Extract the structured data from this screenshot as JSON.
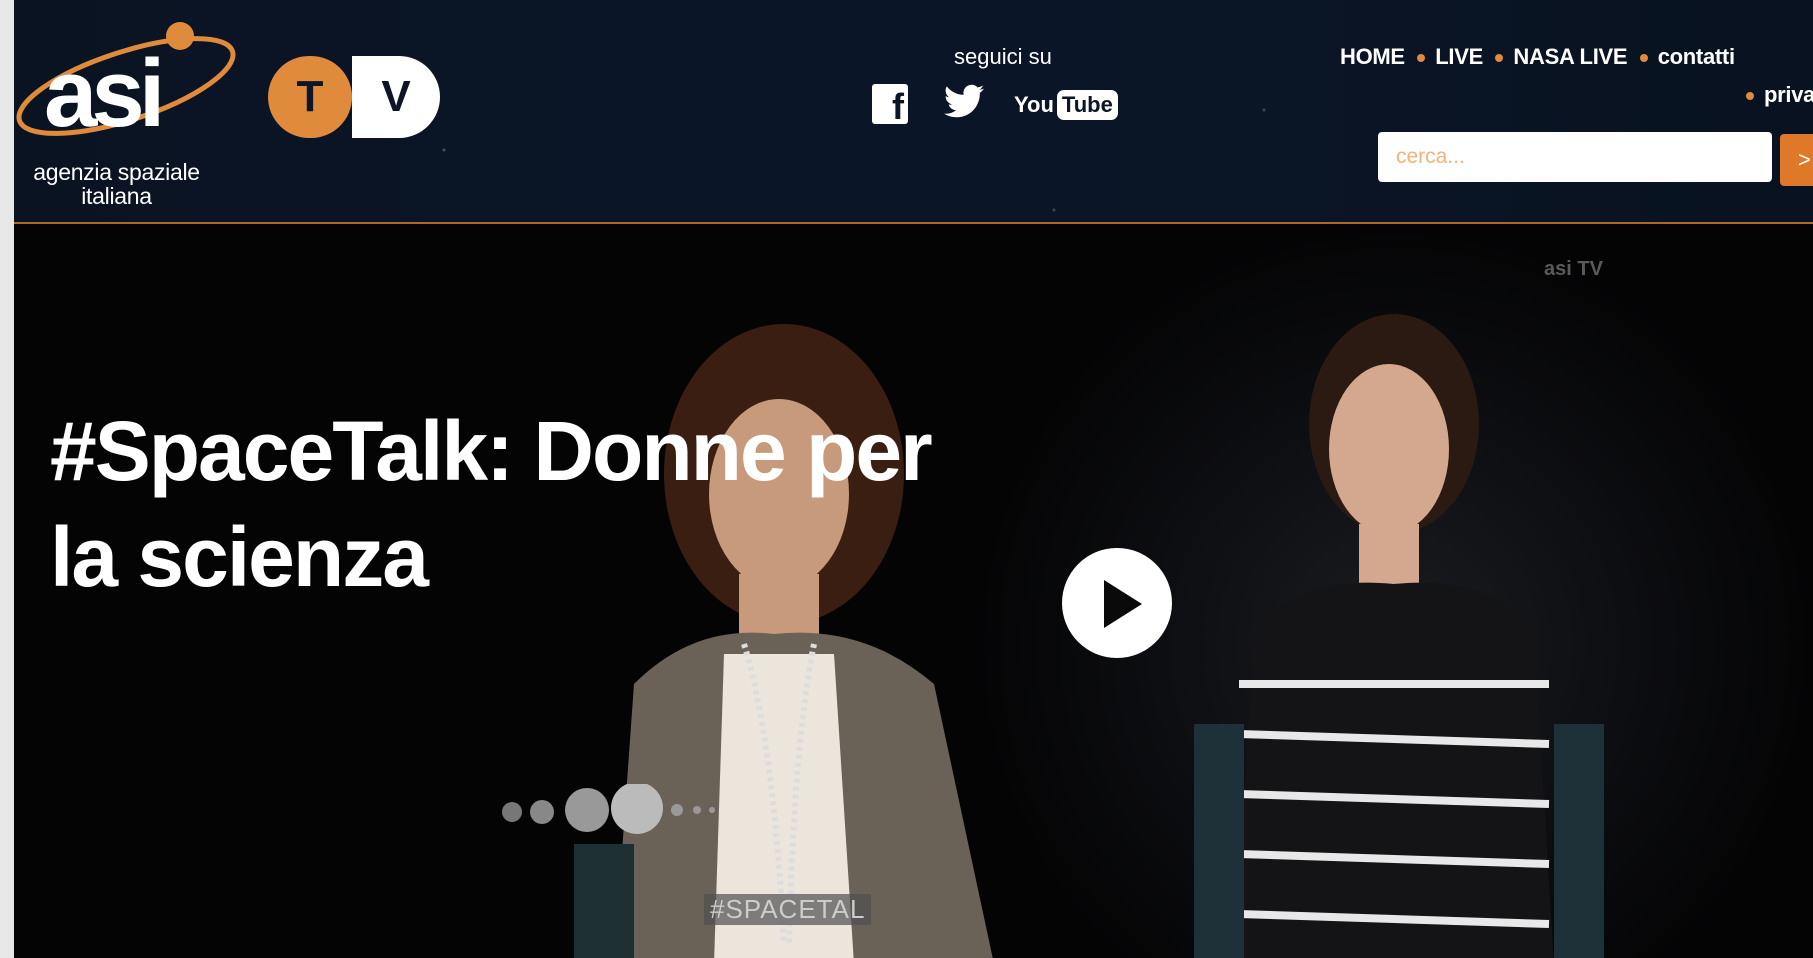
{
  "header": {
    "logo": {
      "brand": "asi",
      "text_line1": "agenzia spaziale",
      "text_line2": "italiana",
      "tv_t": "T",
      "tv_v": "V"
    },
    "social": {
      "label": "seguici su",
      "facebook_glyph": "f",
      "youtube_you": "You",
      "youtube_tube": "Tube"
    },
    "nav": {
      "items": [
        "HOME",
        "LIVE",
        "NASA LIVE",
        "contatti"
      ],
      "sub_items": [
        "privacy"
      ]
    },
    "search": {
      "placeholder": "cerca...",
      "button_label": ">"
    }
  },
  "hero": {
    "title_line1": "#SpaceTalk: Donne per",
    "title_line2": "la scienza",
    "watermark": "asi TV",
    "overlay_tag": "#SPACETAL"
  },
  "colors": {
    "accent": "#e08a3c",
    "header_bg": "#0a1526",
    "hero_bg": "#050506"
  },
  "icons": [
    "facebook-icon",
    "twitter-icon",
    "youtube-icon",
    "play-icon",
    "asi-logo",
    "asi-tv-logo"
  ]
}
